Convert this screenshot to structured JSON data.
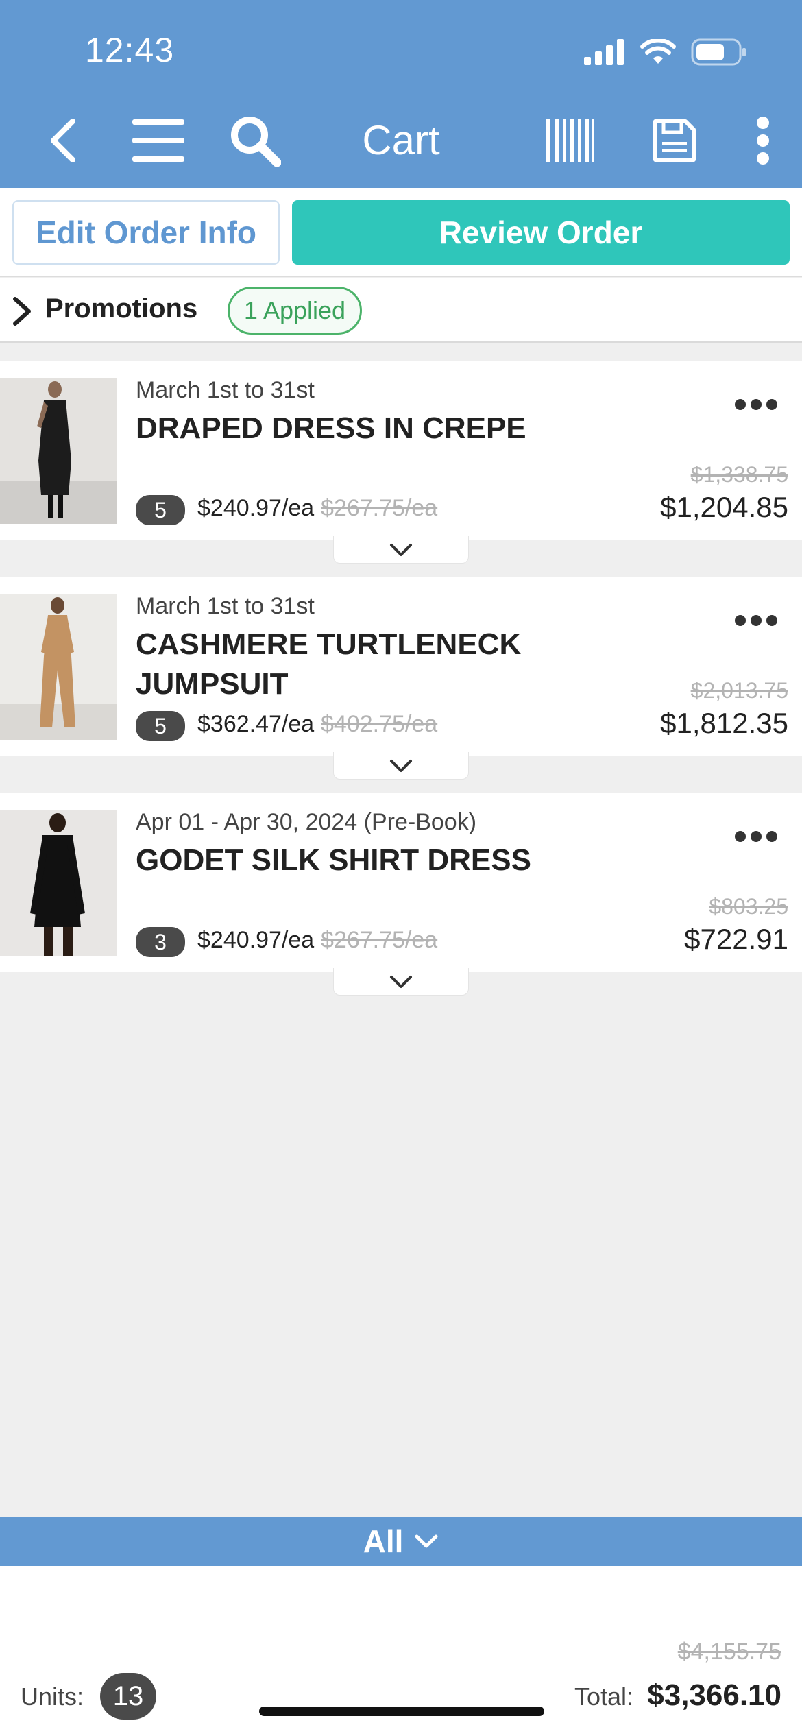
{
  "status_bar": {
    "time": "12:43"
  },
  "nav": {
    "title": "Cart"
  },
  "actions": {
    "edit_label": "Edit Order Info",
    "review_label": "Review Order"
  },
  "promotions": {
    "label": "Promotions",
    "badge": "1 Applied"
  },
  "items": [
    {
      "date": "March 1st to 31st",
      "name": "DRAPED DRESS IN CREPE",
      "qty": "5",
      "unit_price": "$240.97/ea",
      "unit_orig": "$267.75/ea",
      "line_orig": "$1,338.75",
      "line_total": "$1,204.85"
    },
    {
      "date": "March 1st to 31st",
      "name": "CASHMERE TURTLENECK JUMPSUIT",
      "qty": "5",
      "unit_price": "$362.47/ea",
      "unit_orig": "$402.75/ea",
      "line_orig": "$2,013.75",
      "line_total": "$1,812.35"
    },
    {
      "date": "Apr 01 - Apr 30, 2024 (Pre-Book)",
      "name": "GODET SILK SHIRT DRESS",
      "qty": "3",
      "unit_price": "$240.97/ea",
      "unit_orig": "$267.75/ea",
      "line_orig": "$803.25",
      "line_total": "$722.91"
    }
  ],
  "filter": {
    "label": "All"
  },
  "footer": {
    "units_label": "Units:",
    "units_value": "13",
    "total_orig": "$4,155.75",
    "total_label": "Total:",
    "total_value": "$3,366.10"
  },
  "colors": {
    "header": "#6299d2",
    "review": "#2fc6ba",
    "promo": "#4cb36a"
  }
}
